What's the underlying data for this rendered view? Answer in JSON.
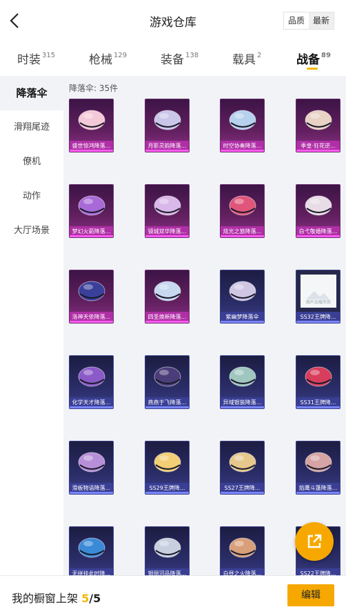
{
  "header": {
    "title": "游戏仓库",
    "back_icon": "chevron-left-icon",
    "sort": {
      "quality": "品质",
      "newest": "最新"
    }
  },
  "tabs": [
    {
      "label": "时装",
      "count": "315"
    },
    {
      "label": "枪械",
      "count": "129"
    },
    {
      "label": "装备",
      "count": "138"
    },
    {
      "label": "载具",
      "count": "2"
    },
    {
      "label": "战备",
      "count": "89"
    }
  ],
  "sidebar": [
    {
      "label": "降落伞"
    },
    {
      "label": "滑翔尾迹"
    },
    {
      "label": "僚机"
    },
    {
      "label": "动作"
    },
    {
      "label": "大厅场景"
    }
  ],
  "main": {
    "count_label": "降落伞: 35件",
    "items": [
      {
        "name": "盛世惊鸿降落...",
        "rarity": "epic",
        "color": "#f3c9d8"
      },
      {
        "name": "月影灵韵降落...",
        "rarity": "epic",
        "color": "#c9c6e8"
      },
      {
        "name": "时空协奏降落...",
        "rarity": "epic",
        "color": "#b6d1ee"
      },
      {
        "name": "季皇·狂花逆...",
        "rarity": "epic",
        "color": "#e8d2c4"
      },
      {
        "name": "梦幻火箭降落...",
        "rarity": "epic",
        "color": "#a86ad8"
      },
      {
        "name": "镜城双华降落...",
        "rarity": "epic",
        "color": "#d9b7e8"
      },
      {
        "name": "炫光之旅降落...",
        "rarity": "epic",
        "color": "#e0557a"
      },
      {
        "name": "白弋敬婚降落...",
        "rarity": "epic",
        "color": "#e8dce6"
      },
      {
        "name": "洛神天依降落...",
        "rarity": "epic",
        "color": "#3a3f9a"
      },
      {
        "name": "四圣焕新降落...",
        "rarity": "epic",
        "color": "#c7d8ef"
      },
      {
        "name": "紫幽梦降落伞",
        "rarity": "rare",
        "color": "#cfc6e4"
      },
      {
        "name": "SS32王牌降...",
        "rarity": "plain",
        "placeholder": "图片加载失败"
      },
      {
        "name": "化学天才降落...",
        "rarity": "rare",
        "color": "#8b5ac8"
      },
      {
        "name": "燕燕于飞降落...",
        "rarity": "rare",
        "color": "#4a3d7a"
      },
      {
        "name": "异域银装降落...",
        "rarity": "rare",
        "color": "#9fc6bf"
      },
      {
        "name": "SS31王牌降...",
        "rarity": "rare",
        "color": "#d83d5c"
      },
      {
        "name": "滑板物语降落...",
        "rarity": "rare",
        "color": "#b78fd8"
      },
      {
        "name": "SS29王牌降...",
        "rarity": "rare",
        "color": "#f2ce74"
      },
      {
        "name": "SS27王牌降...",
        "rarity": "rare",
        "color": "#e6c88c"
      },
      {
        "name": "焰鹰斗篷降落...",
        "rarity": "rare",
        "color": "#d6a4a4"
      },
      {
        "name": "无拼挂此时降...",
        "rarity": "rare",
        "color": "#3b8ad8"
      },
      {
        "name": "银丽河品降落...",
        "rarity": "rare",
        "color": "#c8d0e0"
      },
      {
        "name": "白昼之火降落...",
        "rarity": "rare",
        "color": "#d8a07a"
      },
      {
        "name": "SS22王牌降...",
        "rarity": "rare",
        "color": "#c0c8d8"
      }
    ]
  },
  "fab": {
    "icon": "external-link-icon"
  },
  "footer": {
    "label": "我的橱窗上架",
    "current": "5",
    "separator": "/",
    "total": "5",
    "edit": "编辑"
  },
  "colors": {
    "accent": "#f6a800",
    "epic": "#b02fa6",
    "rare": "#3a3f95"
  }
}
